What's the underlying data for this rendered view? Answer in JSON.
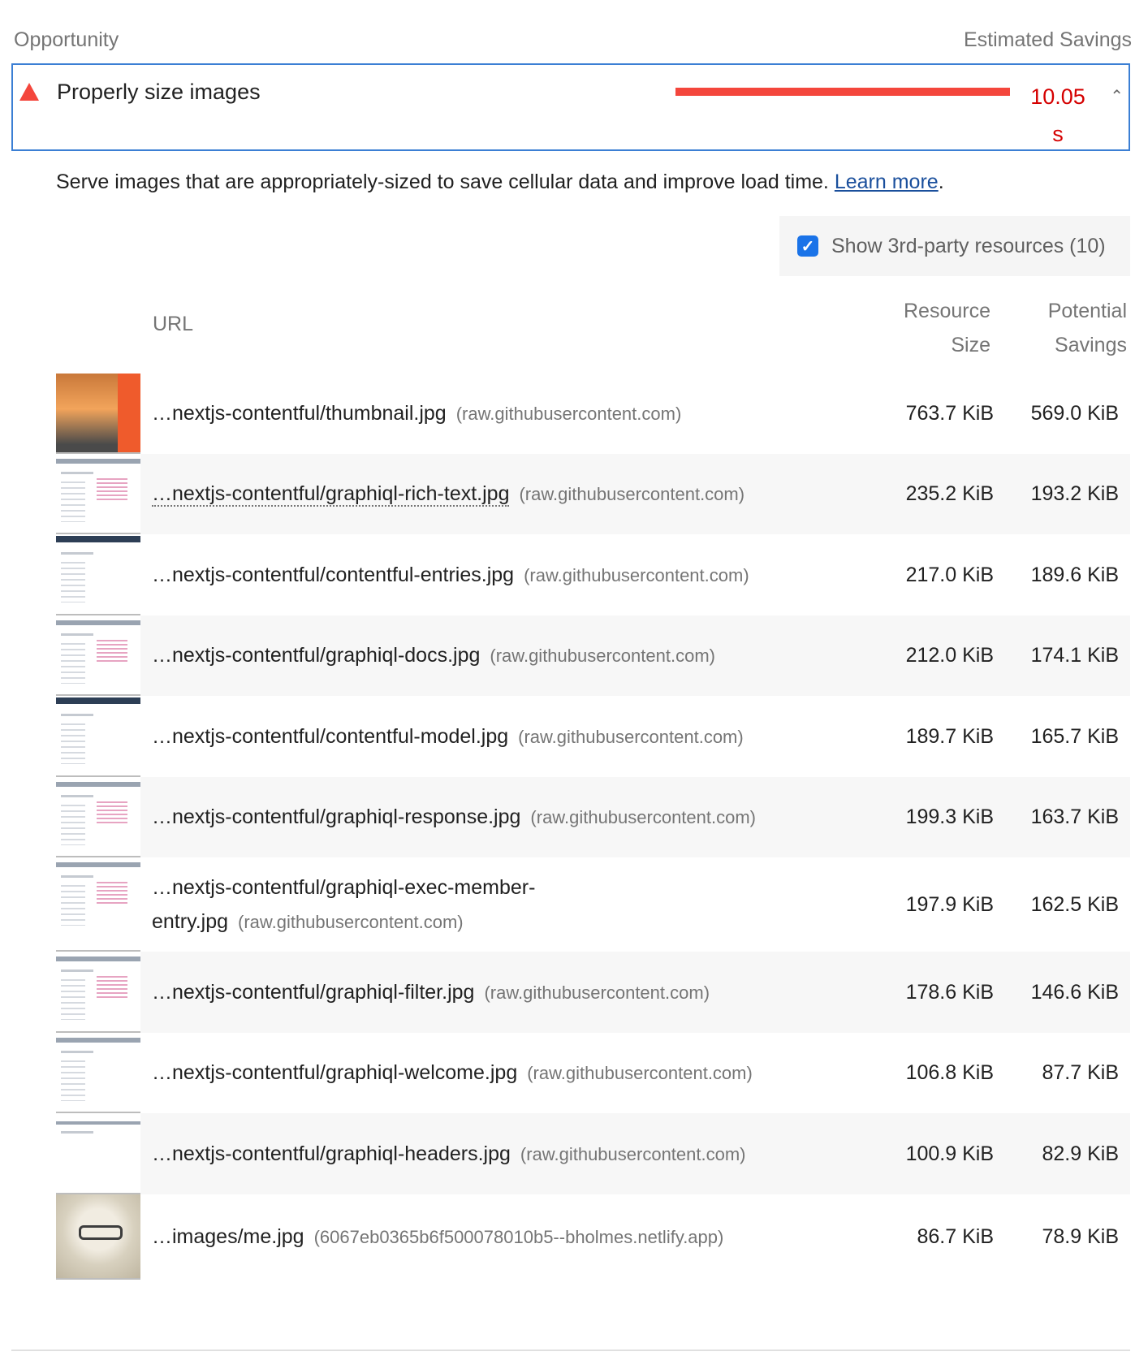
{
  "header": {
    "left": "Opportunity",
    "right": "Estimated Savings"
  },
  "audit": {
    "title": "Properly size images",
    "savings_value": "10.05",
    "savings_unit": "s",
    "description": "Serve images that are appropriately-sized to save cellular data and improve load time. ",
    "learn_more": "Learn more",
    "period": ".",
    "severity_color": "#f4463c"
  },
  "third_party": {
    "checked": true,
    "label": "Show 3rd-party resources (10)"
  },
  "columns": {
    "url": "URL",
    "size_line1": "Resource",
    "size_line2": "Size",
    "savings_line1": "Potential",
    "savings_line2": "Savings"
  },
  "rows": [
    {
      "path": "…nextjs-contentful/thumbnail.jpg",
      "origin": "(raw.githubusercontent.com)",
      "size": "763.7 KiB",
      "savings": "569.0 KiB"
    },
    {
      "path": "…nextjs-contentful/graphiql-rich-text.jpg",
      "origin": "(raw.githubusercontent.com)",
      "size": "235.2 KiB",
      "savings": "193.2 KiB"
    },
    {
      "path": "…nextjs-contentful/contentful-entries.jpg",
      "origin": "(raw.githubusercontent.com)",
      "size": "217.0 KiB",
      "savings": "189.6 KiB"
    },
    {
      "path": "…nextjs-contentful/graphiql-docs.jpg",
      "origin": "(raw.githubusercontent.com)",
      "size": "212.0 KiB",
      "savings": "174.1 KiB"
    },
    {
      "path": "…nextjs-contentful/contentful-model.jpg",
      "origin": "(raw.githubusercontent.com)",
      "size": "189.7 KiB",
      "savings": "165.7 KiB"
    },
    {
      "path": "…nextjs-contentful/graphiql-response.jpg",
      "origin": "(raw.githubusercontent.com)",
      "size": "199.3 KiB",
      "savings": "163.7 KiB"
    },
    {
      "path": "…nextjs-contentful/graphiql-exec-member-entry.jpg",
      "origin": "(raw.githubusercontent.com)",
      "size": "197.9 KiB",
      "savings": "162.5 KiB"
    },
    {
      "path": "…nextjs-contentful/graphiql-filter.jpg",
      "origin": "(raw.githubusercontent.com)",
      "size": "178.6 KiB",
      "savings": "146.6 KiB"
    },
    {
      "path": "…nextjs-contentful/graphiql-welcome.jpg",
      "origin": "(raw.githubusercontent.com)",
      "size": "106.8 KiB",
      "savings": "87.7 KiB"
    },
    {
      "path": "…nextjs-contentful/graphiql-headers.jpg",
      "origin": "(raw.githubusercontent.com)",
      "size": "100.9 KiB",
      "savings": "82.9 KiB"
    },
    {
      "path": "…images/me.jpg",
      "origin": "(6067eb0365b6f500078010b5--bholmes.netlify.app)",
      "size": "86.7 KiB",
      "savings": "78.9 KiB"
    }
  ]
}
